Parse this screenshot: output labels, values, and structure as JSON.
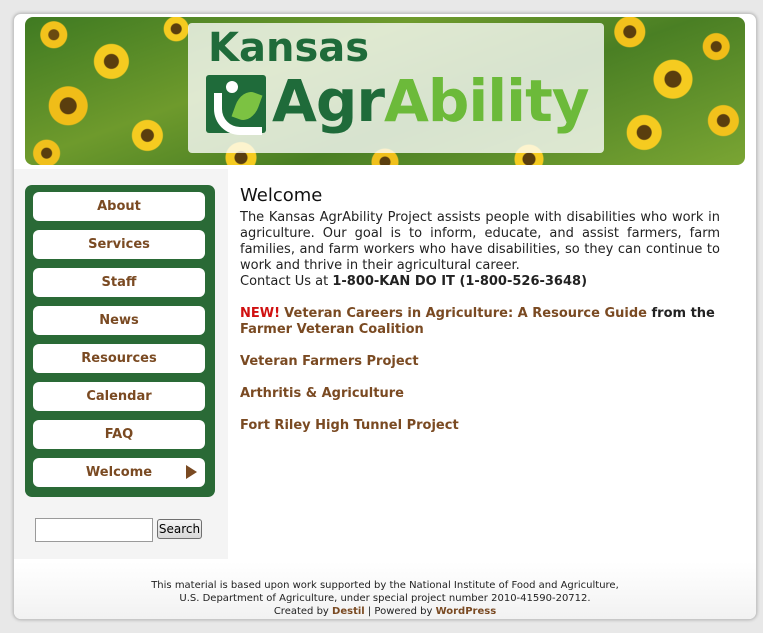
{
  "banner": {
    "logo_line1": "Kansas",
    "logo_line2_part1": "Agr",
    "logo_line2_part2": "Ability"
  },
  "nav": {
    "items": [
      {
        "label": "About"
      },
      {
        "label": "Services"
      },
      {
        "label": "Staff"
      },
      {
        "label": "News"
      },
      {
        "label": "Resources"
      },
      {
        "label": "Calendar"
      },
      {
        "label": "FAQ"
      },
      {
        "label": "Welcome"
      }
    ],
    "active_index": 7
  },
  "search": {
    "value": "",
    "button_label": "Search"
  },
  "main": {
    "title": "Welcome",
    "intro": "The Kansas AgrAbility Project assists people with disabilities who work in agriculture. Our goal is to inform, educate, and assist farmers, farm families, and farm workers who have disabilities, so they can continue to work and thrive in their agricultural career.",
    "contact_prefix": "Contact Us at ",
    "contact_number": "1-800-KAN DO IT (1-800-526-3648)",
    "new_tag": "NEW!",
    "veteran_guide_link": "Veteran Careers in Agriculture: A Resource Guide",
    "from_text": " from the ",
    "coalition_link": "Farmer Veteran Coalition",
    "links": [
      {
        "label": "Veteran Farmers Project"
      },
      {
        "label": "Arthritis & Agriculture"
      },
      {
        "label": "Fort Riley High Tunnel Project"
      }
    ]
  },
  "footer": {
    "line1": "This material is based upon work supported by the National Institute of Food and Agriculture,",
    "line2": "U.S. Department of Agriculture, under special project number 2010-41590-20712.",
    "created_by": "Created by ",
    "creator_link": "Destil",
    "separator": " | Powered by ",
    "powered_link": "WordPress"
  },
  "colors": {
    "nav_green": "#2a6a36",
    "link_brown": "#7a4a22",
    "new_red": "#d01010",
    "logo_green": "#1f6b3a",
    "logo_light_green": "#6cba3a"
  }
}
